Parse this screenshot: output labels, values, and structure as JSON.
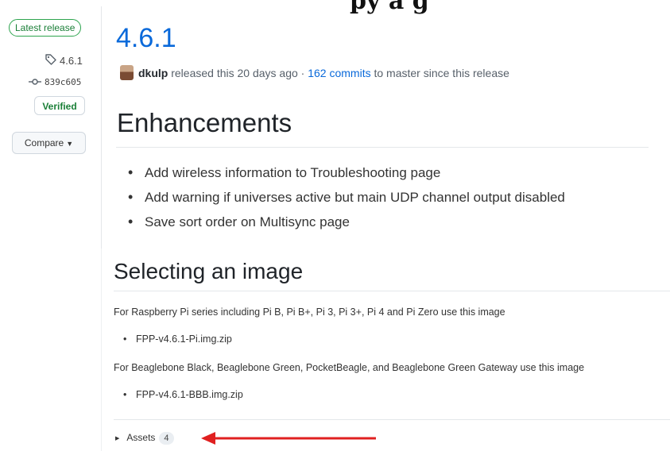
{
  "page_header_fragment": "py a g",
  "sidebar": {
    "latest_badge": "Latest release",
    "tag": "4.6.1",
    "commit": "839c605",
    "verified": "Verified",
    "compare": "Compare"
  },
  "release": {
    "title": "4.6.1",
    "author": "dkulp",
    "released_text": "released this 20 days ago ·",
    "commits_link": "162 commits",
    "commits_suffix": "to master since this release"
  },
  "enhancements": {
    "heading": "Enhancements",
    "items": [
      "Add wireless information to Troubleshooting page",
      "Add warning if universes active but main UDP channel output disabled",
      "Save sort order on Multisync page"
    ]
  },
  "selecting": {
    "heading": "Selecting an image",
    "pi_text": "For Raspberry Pi series including Pi B, Pi B+, Pi 3, Pi 3+, Pi 4 and Pi Zero use this image",
    "pi_file": "FPP-v4.6.1-Pi.img.zip",
    "bbb_text": "For Beaglebone Black, Beaglebone Green, PocketBeagle, and Beaglebone Green Gateway use this image",
    "bbb_file": "FPP-v4.6.1-BBB.img.zip"
  },
  "assets": {
    "label": "Assets",
    "count": "4"
  },
  "colors": {
    "link": "#0969da",
    "verified_green": "#1a7f37",
    "annotation_arrow": "#e02020"
  },
  "icons": [
    "tag-icon",
    "git-commit-icon",
    "caret-down-icon",
    "triangle-right-icon",
    "annotation-arrow"
  ]
}
